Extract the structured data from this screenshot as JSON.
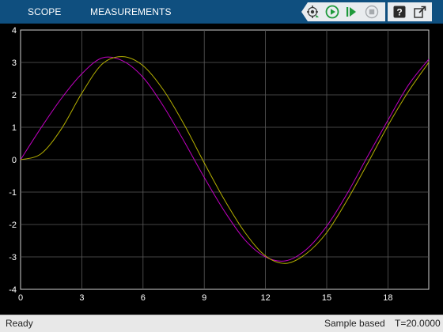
{
  "toolbar": {
    "tabs": [
      {
        "label": "SCOPE"
      },
      {
        "label": "MEASUREMENTS"
      }
    ],
    "buttons": [
      {
        "icon": "settings-gear-icon"
      },
      {
        "icon": "run-icon"
      },
      {
        "icon": "step-forward-icon"
      },
      {
        "icon": "stop-icon"
      },
      {
        "icon": "help-icon"
      },
      {
        "icon": "undock-icon"
      }
    ],
    "colors": {
      "bar": "#0f4f7f",
      "run": "#1f9a3c",
      "step": "#1f9a3c"
    }
  },
  "chart_data": {
    "type": "line",
    "title": "",
    "xlabel": "",
    "ylabel": "",
    "xlim": [
      0,
      20
    ],
    "ylim": [
      -4,
      4
    ],
    "grid": true,
    "x_ticks": [
      "0",
      "3",
      "6",
      "9",
      "12",
      "15",
      "18"
    ],
    "y_ticks": [
      "4",
      "3",
      "2",
      "1",
      "0",
      "-1",
      "-2",
      "-3",
      "-4"
    ],
    "series": [
      {
        "color": "#c000c0",
        "x": [
          0,
          1,
          2,
          3,
          4,
          5,
          6,
          7,
          8,
          9,
          10,
          11,
          12,
          13,
          14,
          15,
          16,
          17,
          18,
          19,
          20
        ],
        "y": [
          0,
          0.98,
          1.89,
          2.65,
          3.14,
          3.05,
          2.54,
          1.65,
          0.58,
          -0.55,
          -1.6,
          -2.48,
          -3.0,
          -3.12,
          -2.77,
          -2.05,
          -1.05,
          0.1,
          1.22,
          2.3,
          3.1
        ]
      },
      {
        "color": "#b5b000",
        "x": [
          0,
          1,
          2,
          3,
          4,
          5,
          6,
          7,
          8,
          9,
          10,
          11,
          12,
          13,
          14,
          15,
          16,
          17,
          18,
          19,
          20
        ],
        "y": [
          0,
          0.18,
          0.95,
          2.05,
          2.95,
          3.18,
          2.9,
          2.15,
          1.1,
          -0.1,
          -1.25,
          -2.25,
          -2.97,
          -3.2,
          -2.9,
          -2.25,
          -1.25,
          -0.12,
          1.05,
          2.1,
          3.0
        ]
      }
    ]
  },
  "status": {
    "ready": "Ready",
    "mode": "Sample based",
    "time": "T=20.0000"
  }
}
